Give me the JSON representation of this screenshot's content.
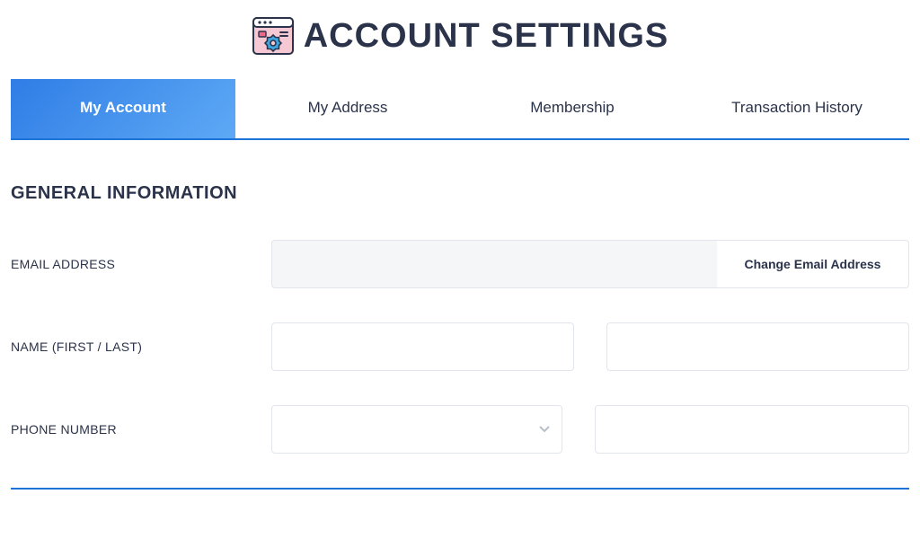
{
  "header": {
    "title": "ACCOUNT SETTINGS"
  },
  "tabs": [
    {
      "label": "My Account",
      "active": true
    },
    {
      "label": "My Address",
      "active": false
    },
    {
      "label": "Membership",
      "active": false
    },
    {
      "label": "Transaction History",
      "active": false
    }
  ],
  "sections": {
    "general": {
      "title": "GENERAL INFORMATION",
      "fields": {
        "email": {
          "label": "EMAIL ADDRESS",
          "value": "",
          "change_button": "Change Email Address"
        },
        "name": {
          "label": "NAME (FIRST / LAST)",
          "first_value": "",
          "last_value": ""
        },
        "phone": {
          "label": "PHONE NUMBER",
          "code_value": "",
          "number_value": ""
        }
      }
    }
  },
  "colors": {
    "primary": "#1c73d8",
    "text": "#2b334b",
    "border": "#e2e5ea",
    "icon_pink": "#f6c8d4",
    "icon_blue": "#3fa7e0"
  }
}
